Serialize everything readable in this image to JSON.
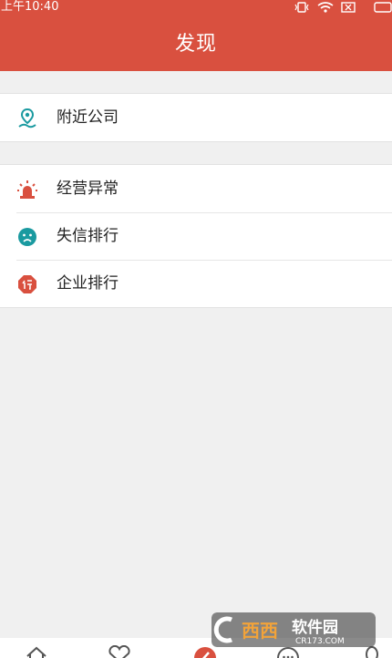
{
  "status_bar": {
    "time": "上午10:40",
    "icons": [
      "vibrate-icon",
      "wifi-icon",
      "sim-card-icon",
      "battery-icon"
    ]
  },
  "header": {
    "title": "发现",
    "background_color": "#d9503f"
  },
  "sections": [
    {
      "items": [
        {
          "label": "附近公司",
          "icon": "location-pin-icon",
          "icon_color": "#1a9aa0"
        }
      ]
    },
    {
      "items": [
        {
          "label": "经营异常",
          "icon": "alarm-light-icon",
          "icon_color": "#d9503f"
        },
        {
          "label": "失信排行",
          "icon": "sad-face-icon",
          "icon_color": "#1a9aa0"
        },
        {
          "label": "企业排行",
          "icon": "hexagon-rank-icon",
          "icon_color": "#d9503f"
        }
      ]
    }
  ],
  "bottom_nav": {
    "icons": [
      "home-icon",
      "heart-icon",
      "discover-icon",
      "chat-icon",
      "profile-icon"
    ],
    "active_index": 2
  },
  "watermark": {
    "logo": "cr173-watermark-logo",
    "text": "西西软件园",
    "sub_text": "CR173.COM"
  }
}
